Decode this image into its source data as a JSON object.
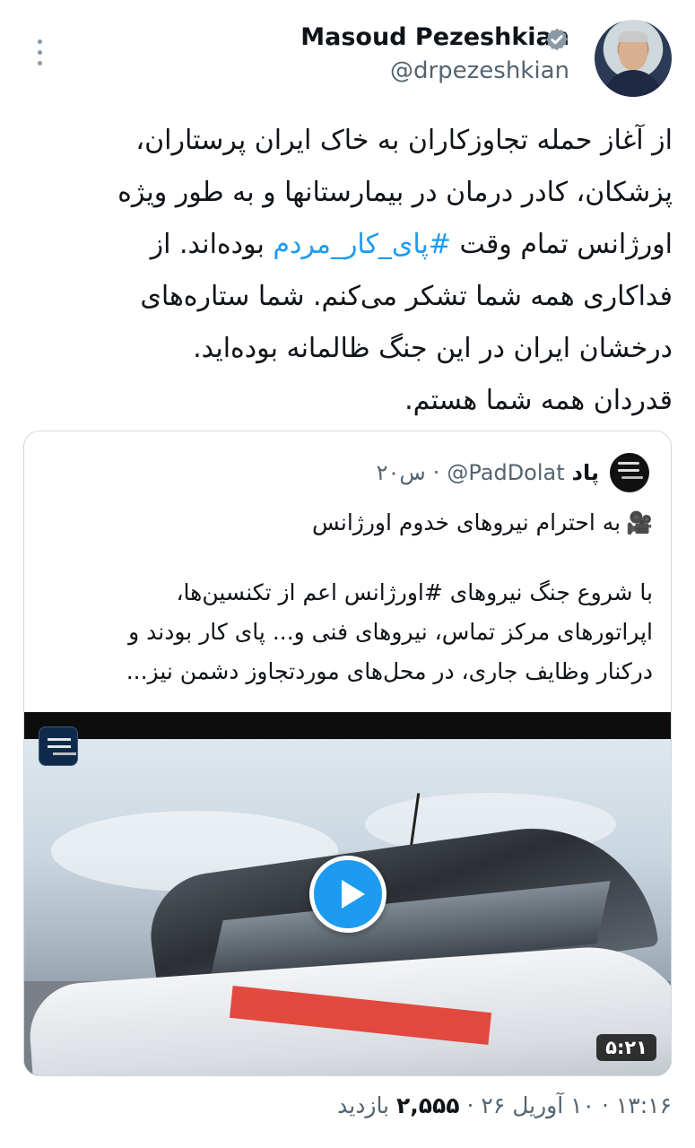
{
  "author": {
    "name": "Masoud Pezeshkian",
    "handle": "@drpezeshkian",
    "verified": true,
    "verified_color": "#8b98a5"
  },
  "tweet": {
    "lines": [
      {
        "text": "از آغاز حمله تجاوزکاران به خاک ایران پرستاران،"
      },
      {
        "text": "پزشکان، کادر درمان در بیمارستانها و به طور ویژه"
      },
      {
        "before": "اورژانس تمام وقت ",
        "hashtag": "#پای_کار_مردم",
        "after": " بوده‌اند. از"
      },
      {
        "text": "فداکاری همه شما تشکر می‌کنم. شما ستاره‌های"
      },
      {
        "text": "درخشان ایران در این جنگ ظالمانه بوده‌اید."
      },
      {
        "text": "قدردان همه شما هستم."
      }
    ],
    "hashtag_color": "#1d9bf0"
  },
  "quote": {
    "name": "پاد",
    "handle": "@PadDolat",
    "separator": "·",
    "time": "۲۰س",
    "title_icon": "video-camera-icon",
    "title": "به احترام نیروهای خدوم اورژانس",
    "body_lines": [
      "با شروع جنگ نیروهای #اورژانس اعم از تکنسین‌ها،",
      "اپراتورهای مرکز تماس، نیروهای فنی و... پای کار بودند و",
      "درکنار وظایف جاری، در محل‌های موردتجاوز دشمن نیز..."
    ],
    "video": {
      "duration": "۵:۲۱",
      "play_color": "#1d9bf0"
    }
  },
  "meta": {
    "time": "۱۳:۱۶",
    "dot1": "·",
    "date": "۱۰ آوریل ۲۶",
    "dot2": "·",
    "views": "۲,۵۵۵",
    "views_label": "بازدید"
  }
}
